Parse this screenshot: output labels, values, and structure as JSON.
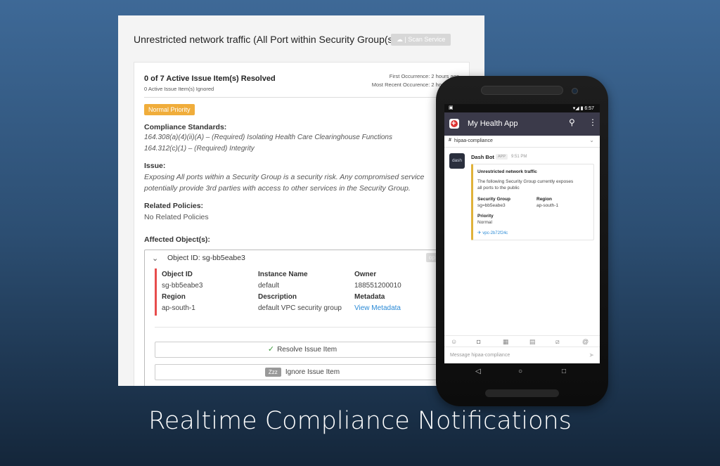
{
  "panel": {
    "title": "Unrestricted network traffic (All Port within Security Group(s))",
    "scan_service": "☁ | Scan Service",
    "resolved": "0 of 7 Active Issue Item(s) Resolved",
    "ignored": "0 Active Issue Item(s) Ignored",
    "first_occurrence": "First Occurrence: 2 hours ago",
    "recent_occurrence": "Most Recent Occurence: 2 hours ago",
    "priority": "Normal Priority",
    "standards_label": "Compliance Standards:",
    "standards": [
      "164.308(a)(4)(ii)(A) – (Required) Isolating Health Care Clearinghouse Functions",
      "164.312(c)(1) – (Required) Integrity"
    ],
    "issue_label": "Issue:",
    "issue_lines": [
      "Exposing All ports within a Security Group is a security risk. Any compromised service",
      "potentially provide 3rd parties with access to other services in the Security Group."
    ],
    "related_label": "Related Policies:",
    "related_value": "No Related Policies",
    "affected_label": "Affected Object(s):",
    "object_header": "Object ID: sg-bb5eabe3",
    "open_tag": "op",
    "object": {
      "id_label": "Object ID",
      "id_value": "sg-bb5eabe3",
      "instance_label": "Instance Name",
      "instance_value": "default",
      "owner_label": "Owner",
      "owner_value": "188551200010",
      "region_label": "Region",
      "region_value": "ap-south-1",
      "description_label": "Description",
      "description_value": "default VPC security group",
      "metadata_label": "Metadata",
      "metadata_link": "View Metadata"
    },
    "resolve_button": "Resolve Issue Item",
    "ignore_zzz": "Zzz",
    "ignore_button": "Ignore Issue Item"
  },
  "phone": {
    "time": "6:57",
    "app_title": "My Health App",
    "channel": "hipaa-compliance",
    "bot_name": "Dash Bot",
    "bot_avatar": "dash",
    "app_tag": "APP",
    "bot_time": "9:51 PM",
    "attachment": {
      "title": "Unrestricted network traffic",
      "text_line1": "The following Security Group currently exposes",
      "text_line2": "all ports to the public",
      "sg_label": "Security Group",
      "sg_value": "sg=bb5eabe3",
      "region_label": "Region",
      "region_value": "ap-south-1",
      "priority_label": "Priority",
      "priority_value": "Normal",
      "vpc": "vpc-2b72f24c"
    },
    "composer_placeholder": "Message hipaa-compliance"
  },
  "caption": "Realtime Compliance Notifications"
}
